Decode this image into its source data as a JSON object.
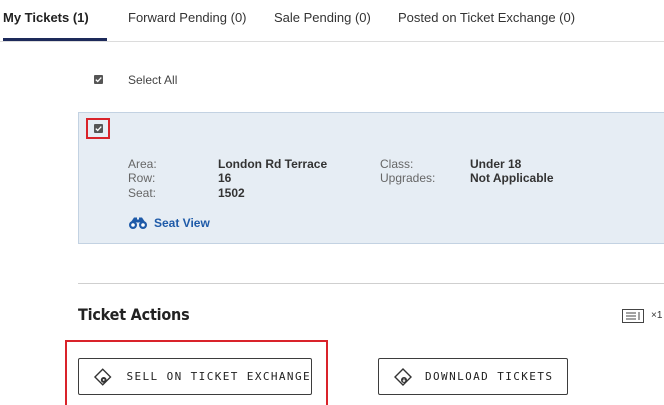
{
  "tabs": [
    {
      "label": "My Tickets (1)"
    },
    {
      "label": "Forward Pending (0)"
    },
    {
      "label": "Sale Pending (0)"
    },
    {
      "label": "Posted on Ticket Exchange (0)"
    }
  ],
  "select_all": {
    "label": "Select All"
  },
  "ticket": {
    "area_label": "Area:",
    "area_value": "London Rd Terrace",
    "row_label": "Row:",
    "row_value": "16",
    "seat_label": "Seat:",
    "seat_value": "1502",
    "class_label": "Class:",
    "class_value": "Under 18",
    "upgrades_label": "Upgrades:",
    "upgrades_value": "Not Applicable",
    "seat_view_label": "Seat View"
  },
  "actions": {
    "title": "Ticket Actions",
    "count": "×1",
    "sell_label": "SELL ON TICKET EXCHANGE",
    "download_label": "DOWNLOAD TICKETS"
  },
  "colors": {
    "accent": "#1d2a5a",
    "highlight": "#d9232a",
    "card_bg": "#e6edf4",
    "link": "#1e5aa8"
  },
  "icons": [
    "checkbox-check-icon",
    "binoculars-icon",
    "list-icon",
    "ticket-icon"
  ]
}
